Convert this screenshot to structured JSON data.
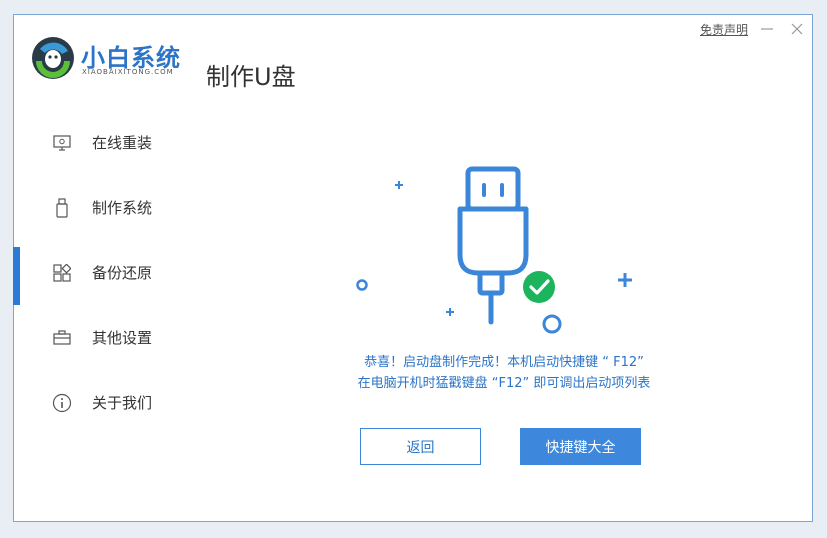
{
  "brand": {
    "name": "小白系统",
    "subtitle": "XIAOBAIXITONG.COM"
  },
  "page_title": "制作U盘",
  "titlebar": {
    "disclaimer": "免责声明"
  },
  "sidebar": {
    "active_index": 2,
    "items": [
      {
        "label": "在线重装",
        "icon": "monitor-icon"
      },
      {
        "label": "制作系统",
        "icon": "usb-drive-icon"
      },
      {
        "label": "备份还原",
        "icon": "grid-icon"
      },
      {
        "label": "其他设置",
        "icon": "toolbox-icon"
      },
      {
        "label": "关于我们",
        "icon": "info-icon"
      }
    ]
  },
  "main": {
    "message_line1": "恭喜！启动盘制作完成！本机启动快捷键 “ F12”",
    "message_line2": "在电脑开机时猛戳键盘 “F12” 即可调出启动项列表",
    "back_button": "返回",
    "shortcut_button": "快捷键大全"
  },
  "colors": {
    "accent": "#2b7ad6",
    "success": "#1db45e",
    "text": "#333333"
  }
}
